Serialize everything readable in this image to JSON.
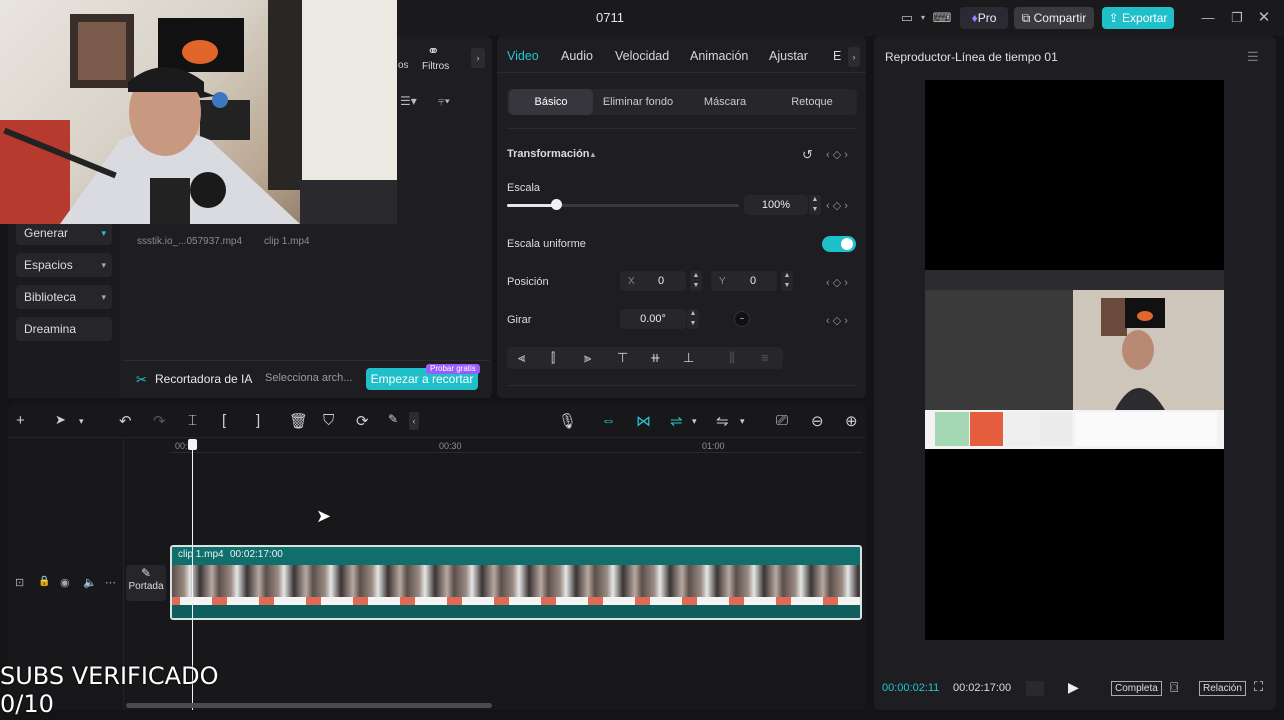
{
  "titlebar": {
    "project_name": "0711",
    "pro_label": "Pro",
    "share_label": "Compartir",
    "export_label": "Exportar"
  },
  "media": {
    "tabs_partial": [
      "os",
      "Filtros"
    ],
    "sidebar": [
      {
        "label": "Generar"
      },
      {
        "label": "Espacios"
      },
      {
        "label": "Biblioteca"
      },
      {
        "label": "Dreamina"
      }
    ],
    "files": [
      "ssstik.io_...057937.mp4",
      "clip 1.mp4"
    ],
    "ai_bar": {
      "title": "Recortadora de IA",
      "placeholder": "Selecciona arch...",
      "start_label": "Empezar a recortar",
      "badge": "Probar gratis"
    }
  },
  "properties": {
    "tabs": [
      "Video",
      "Audio",
      "Velocidad",
      "Animación",
      "Ajustar",
      "E"
    ],
    "subtabs": [
      "Básico",
      "Eliminar fondo",
      "Máscara",
      "Retoque"
    ],
    "section": "Transformación",
    "scale": {
      "label": "Escala",
      "value": "100%",
      "fraction": 0.21
    },
    "uniform_scale": {
      "label": "Escala uniforme",
      "on": true
    },
    "position": {
      "label": "Posición",
      "x_label": "X",
      "x": "0",
      "y_label": "Y",
      "y": "0"
    },
    "rotate": {
      "label": "Girar",
      "value": "0.00°"
    }
  },
  "timeline": {
    "ruler": [
      "00:00",
      "00:30",
      "01:00"
    ],
    "clip": {
      "name": "clip 1.mp4",
      "duration": "00:02:17:00"
    },
    "cover_label": "Portada"
  },
  "player": {
    "title": "Reproductor-Línea de tiempo 01",
    "current": "00:00:02:11",
    "total": "00:02:17:00",
    "full_label": "Completa",
    "ratio_label": "Relación"
  },
  "overlay": {
    "line1": "SUBS VERIFICADO",
    "line2": "0/10"
  },
  "colors": {
    "accent": "#1fc0c9",
    "background": "#141416",
    "panel": "#1e1e22"
  }
}
